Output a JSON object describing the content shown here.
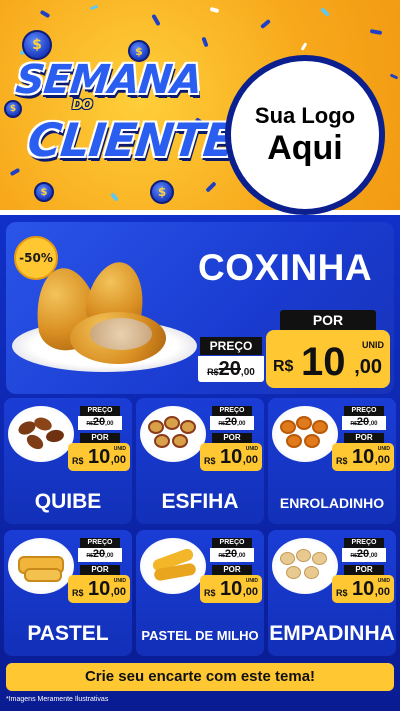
{
  "colors": {
    "header_yellow": "#f7a81b",
    "brand_blue": "#0b1f8f",
    "card_blue": "#1a3dd6",
    "price_yellow": "#ffc832"
  },
  "header": {
    "title_line1": "SEMANA",
    "title_line2": "DO",
    "title_line3": "CLIENTE",
    "logo_line1": "Sua Logo",
    "logo_line2": "Aqui"
  },
  "featured": {
    "discount": "-50%",
    "name": "COXINHA",
    "old_label": "PREÇO",
    "old_currency": "R$",
    "old_int": "20",
    "old_cents": ",00",
    "new_label": "POR",
    "new_currency": "R$",
    "new_int": "10",
    "new_cents": ",00",
    "unit": "UNID"
  },
  "products": [
    {
      "name": "QUIBE",
      "old_label": "PREÇO",
      "old_currency": "R$",
      "old_int": "20",
      "old_cents": ",00",
      "new_label": "POR",
      "new_currency": "R$",
      "new_int": "10",
      "new_cents": ",00",
      "unit": "UNID"
    },
    {
      "name": "ESFIHA",
      "old_label": "PREÇO",
      "old_currency": "R$",
      "old_int": "20",
      "old_cents": ",00",
      "new_label": "POR",
      "new_currency": "R$",
      "new_int": "10",
      "new_cents": ",00",
      "unit": "UNID"
    },
    {
      "name": "ENROLADINHO",
      "old_label": "PREÇO",
      "old_currency": "R$",
      "old_int": "20",
      "old_cents": ",00",
      "new_label": "POR",
      "new_currency": "R$",
      "new_int": "10",
      "new_cents": ",00",
      "unit": "UNID"
    },
    {
      "name": "PASTEL",
      "old_label": "PREÇO",
      "old_currency": "R$",
      "old_int": "20",
      "old_cents": ",00",
      "new_label": "POR",
      "new_currency": "R$",
      "new_int": "10",
      "new_cents": ",00",
      "unit": "UNID"
    },
    {
      "name": "PASTEL DE MILHO",
      "old_label": "PREÇO",
      "old_currency": "R$",
      "old_int": "20",
      "old_cents": ",00",
      "new_label": "POR",
      "new_currency": "R$",
      "new_int": "10",
      "new_cents": ",00",
      "unit": "UNID"
    },
    {
      "name": "EMPADINHA",
      "old_label": "PREÇO",
      "old_currency": "R$",
      "old_int": "20",
      "old_cents": ",00",
      "new_label": "POR",
      "new_currency": "R$",
      "new_int": "10",
      "new_cents": ",00",
      "unit": "UNID"
    }
  ],
  "footer": {
    "cta": "Crie seu encarte com este tema!",
    "disclaimer": "*Imagens Meramente Ilustrativas"
  }
}
